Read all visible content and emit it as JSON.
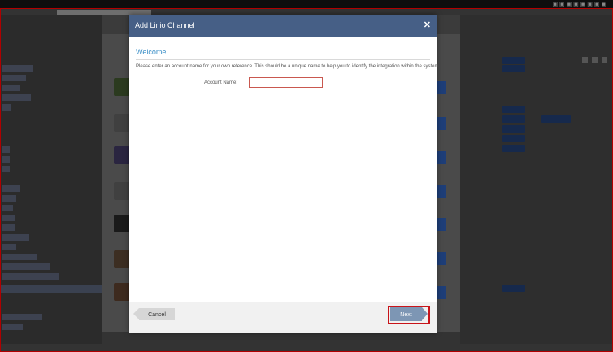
{
  "modal": {
    "title": "Add Linio Channel",
    "close_icon": "close-icon",
    "welcome_heading": "Welcome",
    "instructions": "Please enter an account name for your own reference. This should be a unique name to help you to identify the integration within the system.",
    "account_name_label": "Account Name:",
    "account_name_value": "",
    "account_name_placeholder": "",
    "cancel_label": "Cancel",
    "next_label": "Next"
  },
  "colors": {
    "header": "#465f86",
    "welcome": "#3b8fc7",
    "next_button": "#7d96b4",
    "highlight": "#c8141a"
  }
}
